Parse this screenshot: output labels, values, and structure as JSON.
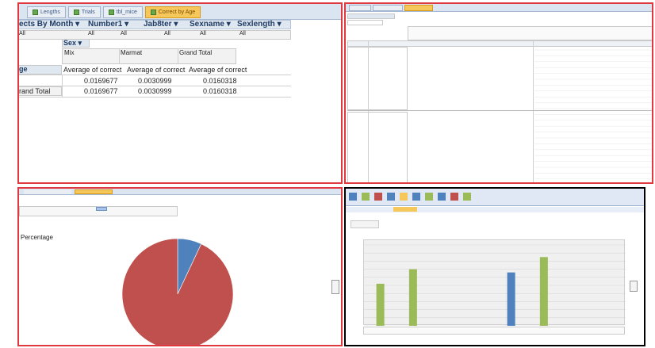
{
  "panel_tl": {
    "tabs": [
      {
        "label": "Lengths",
        "active": false
      },
      {
        "label": "Trials",
        "active": false
      },
      {
        "label": "tbl_mice",
        "active": false
      },
      {
        "label": "Correct by Age",
        "active": true
      }
    ],
    "field_headers": [
      "ects By Month ▾",
      "Number1 ▾",
      "Jab8ter ▾",
      "Sexname ▾",
      "Sexlength ▾"
    ],
    "field_values": [
      "All",
      "All",
      "All",
      "All",
      "All",
      "All"
    ],
    "col_header": "Sex ▾",
    "col_labels": [
      "Mix",
      "Marmat",
      "Grand Total"
    ],
    "row_header": "ge",
    "measure_labels": [
      "Average of correct",
      "Average of correct",
      "Average of correct"
    ],
    "rows": [
      {
        "label": "",
        "values": [
          "0.0169677",
          "0.0030999",
          "0.0160318"
        ]
      },
      {
        "label": "rand Total",
        "values": [
          "0.0169677",
          "0.0030999",
          "0.0160318"
        ]
      }
    ]
  },
  "panel_tr": {
    "tabs": [
      {
        "label": "",
        "active": false
      },
      {
        "label": "",
        "active": false
      },
      {
        "label": "",
        "active": true
      }
    ]
  },
  "panel_bl": {
    "title": "",
    "legend_label": "",
    "pie_label": "Percentage",
    "slice_label": "",
    "colors": {
      "main": "#c0504d",
      "small": "#4f81bd"
    }
  },
  "panel_br": {
    "tab": "",
    "chart_title": "",
    "y_label": ""
  },
  "chart_data": [
    {
      "type": "pie",
      "values": [
        93,
        7
      ],
      "colors": [
        "#c0504d",
        "#4f81bd"
      ]
    },
    {
      "type": "bar",
      "categories": [
        "",
        "",
        "",
        "",
        "",
        "",
        "",
        ""
      ],
      "values": [
        52,
        70,
        0,
        0,
        66,
        85,
        0,
        0
      ],
      "bar_colors": [
        "#9bbb59",
        "#9bbb59",
        "",
        "",
        "#4f81bd",
        "#9bbb59",
        "",
        ""
      ],
      "ylim": [
        0,
        100
      ],
      "grid": true
    }
  ]
}
